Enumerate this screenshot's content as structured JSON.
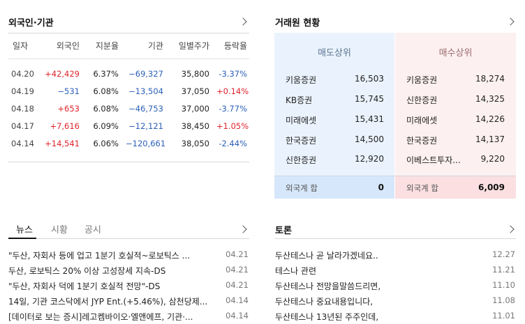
{
  "foreign_inst": {
    "title": "외국인·기관",
    "headers": [
      "일자",
      "외국인",
      "지분율",
      "기관",
      "일별주가",
      "등락율"
    ],
    "rows": [
      {
        "date": "04.20",
        "foreign": "+42,429",
        "ratio": "6.37%",
        "inst": "−69,327",
        "price": "35,800",
        "change": "-3.37%",
        "fdir": "up",
        "idir": "down",
        "cdir": "down"
      },
      {
        "date": "04.19",
        "foreign": "−531",
        "ratio": "6.08%",
        "inst": "−13,504",
        "price": "37,050",
        "change": "+0.14%",
        "fdir": "down",
        "idir": "down",
        "cdir": "up"
      },
      {
        "date": "04.18",
        "foreign": "+653",
        "ratio": "6.08%",
        "inst": "−46,753",
        "price": "37,000",
        "change": "-3.77%",
        "fdir": "up",
        "idir": "down",
        "cdir": "down"
      },
      {
        "date": "04.17",
        "foreign": "+7,616",
        "ratio": "6.09%",
        "inst": "−12,121",
        "price": "38,450",
        "change": "+1.05%",
        "fdir": "up",
        "idir": "down",
        "cdir": "up"
      },
      {
        "date": "04.14",
        "foreign": "+14,541",
        "ratio": "6.06%",
        "inst": "−120,661",
        "price": "38,050",
        "change": "-2.44%",
        "fdir": "up",
        "idir": "down",
        "cdir": "down"
      }
    ]
  },
  "brokers": {
    "title": "거래원 현황",
    "sell_header": "매도상위",
    "buy_header": "매수상위",
    "sell": [
      {
        "name": "키움증권",
        "value": "16,503"
      },
      {
        "name": "KB증권",
        "value": "15,745"
      },
      {
        "name": "미래에셋",
        "value": "15,431"
      },
      {
        "name": "한국증권",
        "value": "14,500"
      },
      {
        "name": "신한증권",
        "value": "12,920"
      }
    ],
    "buy": [
      {
        "name": "키움증권",
        "value": "18,274"
      },
      {
        "name": "신한증권",
        "value": "14,325"
      },
      {
        "name": "미래에셋",
        "value": "14,226"
      },
      {
        "name": "한국증권",
        "value": "14,137"
      },
      {
        "name": "이베스트투자...",
        "value": "9,220"
      }
    ],
    "sell_total_label": "외국계 합",
    "sell_total_value": "0",
    "buy_total_label": "외국계 합",
    "buy_total_value": "6,009",
    "colors": {
      "sell_bg": "#eaf3fd",
      "buy_bg": "#fdf0f0",
      "sell_total_bg": "#d6e7fb",
      "buy_total_bg": "#fbdfe1"
    }
  },
  "news": {
    "tabs": [
      "뉴스",
      "시황",
      "공시"
    ],
    "items": [
      {
        "title": "\"두산, 자회사 등에 업고 1분기 호실적~로보틱스 ...",
        "date": "04.21"
      },
      {
        "title": "두산, 로보틱스 20% 이상 고성장세 지속-DS",
        "date": "04.21"
      },
      {
        "title": "\"두산, 자회사 덕에 1분기 호실적 전망\"-DS",
        "date": "04.21"
      },
      {
        "title": "14일, 기관 코스닥에서 JYP Ent.(+5.46%), 삼천당제...",
        "date": "04.14"
      },
      {
        "title": "[데이터로 보는 증시]레고켐바이오·엘앤에프, 기관·...",
        "date": "04.14"
      }
    ]
  },
  "discussion": {
    "title": "토론",
    "items": [
      {
        "title": "두산테스나 곧 날라가겠네요..",
        "date": "12.27"
      },
      {
        "title": "테스나 관련",
        "date": "11.21"
      },
      {
        "title": "두산테스나 전망을말씀드리면,",
        "date": "11.10"
      },
      {
        "title": "두산테스나 중요내용입니다,",
        "date": "11.08"
      },
      {
        "title": "두산테스나 13년된 주주인데,",
        "date": "11.01"
      }
    ]
  }
}
